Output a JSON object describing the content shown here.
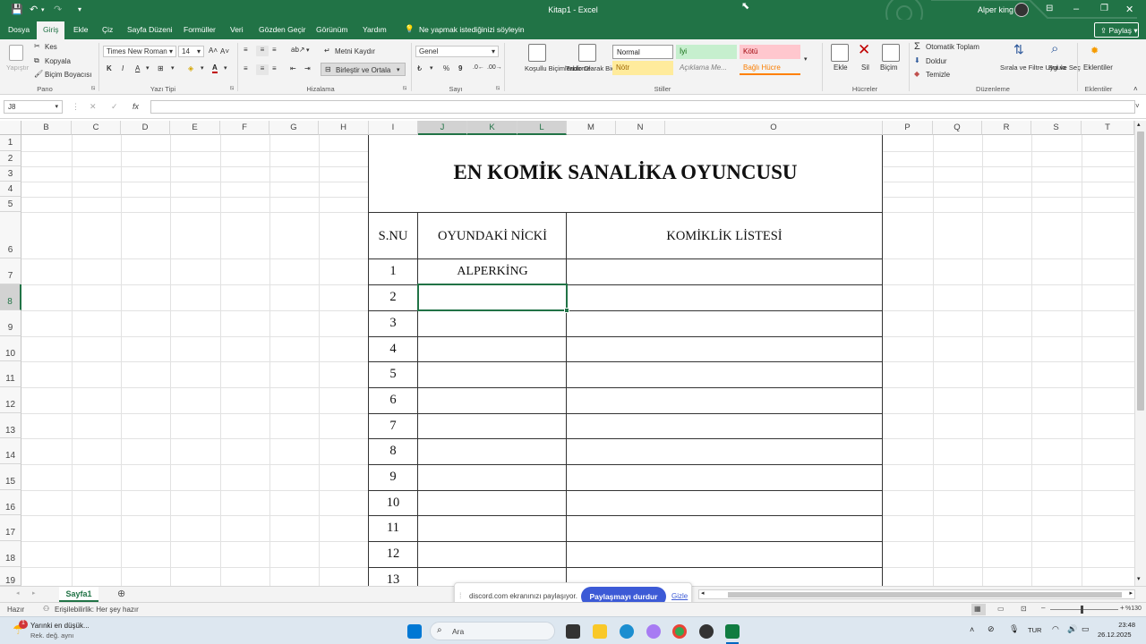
{
  "window": {
    "title": "Kitap1 - Excel",
    "user": "Alper king"
  },
  "menu": {
    "items": [
      "Dosya",
      "Giriş",
      "Ekle",
      "Çiz",
      "Sayfa Düzeni",
      "Formüller",
      "Veri",
      "Gözden Geçir",
      "Görünüm",
      "Yardım"
    ],
    "active": "Giriş",
    "tell_me": "Ne yapmak istediğinizi söyleyin",
    "share": "Paylaş"
  },
  "ribbon": {
    "clipboard": {
      "paste": "Yapıştır",
      "cut": "Kes",
      "copy": "Kopyala",
      "painter": "Biçim Boyacısı",
      "group": "Pano"
    },
    "font": {
      "name": "Times New Roman",
      "size": "14",
      "bold": "K",
      "italic": "I",
      "underline": "A",
      "color_letter": "A",
      "group": "Yazı Tipi"
    },
    "alignment": {
      "wrap": "Metni Kaydır",
      "merge": "Birleştir ve Ortala",
      "group": "Hizalama"
    },
    "number": {
      "format": "Genel",
      "percent": "%",
      "comma": "9",
      "group": "Sayı"
    },
    "styles": {
      "conditional": "Koşullu Biçimlendirme",
      "table": "Tablo Olarak Biçimlendir",
      "normal": "Normal",
      "good": "İyi",
      "bad": "Kötü",
      "neutral": "Nötr",
      "explanatory": "Açıklama Me...",
      "linked": "Bağlı Hücre",
      "group": "Stiller"
    },
    "cells": {
      "insert": "Ekle",
      "delete": "Sil",
      "format": "Biçim",
      "group": "Hücreler"
    },
    "editing": {
      "autosum": "Otomatik Toplam",
      "fill": "Doldur",
      "clear": "Temizle",
      "sort": "Sırala ve Filtre Uygula",
      "find": "Bul ve Seç",
      "group": "Düzenleme"
    },
    "addins": {
      "label": "Eklentiler",
      "group": "Eklentiler"
    }
  },
  "formula_bar": {
    "name_box": "J8",
    "fx": "fx",
    "value": ""
  },
  "grid": {
    "columns": [
      "B",
      "C",
      "D",
      "E",
      "F",
      "G",
      "H",
      "I",
      "J",
      "K",
      "L",
      "M",
      "N",
      "O",
      "P",
      "Q",
      "R",
      "S",
      "T"
    ],
    "rows": [
      "1",
      "2",
      "3",
      "4",
      "5",
      "6",
      "7",
      "8",
      "9",
      "10",
      "11",
      "12",
      "13",
      "14",
      "15",
      "16",
      "17",
      "18",
      "19"
    ],
    "selected_cell": "J8"
  },
  "sheet": {
    "heading": "EN KOMİK SANALİKA OYUNCUSU",
    "headers": [
      "S.NU",
      "OYUNDAKİ NİCKİ",
      "KOMİKLİK LİSTESİ"
    ],
    "numbers": [
      "1",
      "2",
      "3",
      "4",
      "5",
      "6",
      "7",
      "8",
      "9",
      "10",
      "11",
      "12",
      "13"
    ],
    "nick_1": "ALPERKİNG"
  },
  "sheet_tabs": {
    "active": "Sayfa1"
  },
  "discord_banner": {
    "text": "discord.com ekranınızı paylaşıyor.",
    "stop": "Paylaşmayı durdur",
    "hide": "Gizle"
  },
  "status": {
    "ready": "Hazır",
    "accessibility": "Erişilebilirlik: Her şey hazır",
    "zoom": "%130"
  },
  "taskbar": {
    "news_title": "Yarınki en düşük...",
    "news_sub": "Rek. değ. aynı",
    "search": "Ara",
    "lang": "TUR",
    "time": "23:48",
    "date": "26.12.2025"
  },
  "colors": {
    "accent": "#217346",
    "discord": "#3c5ad6"
  }
}
